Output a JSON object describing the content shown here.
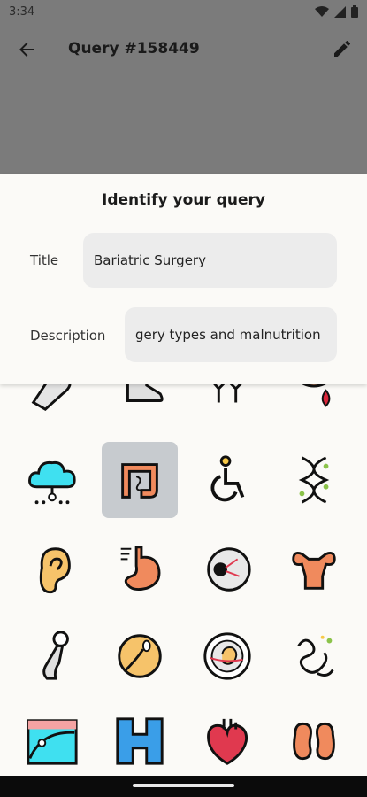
{
  "status": {
    "time": "3:34"
  },
  "appbar": {
    "title": "Query #158449"
  },
  "sheet": {
    "title": "Identify your query",
    "title_label": "Title",
    "title_value": "Bariatric Surgery",
    "description_label": "Description",
    "description_value": "gery types and malnutrition"
  },
  "icons": [
    {
      "name": "bone-icon"
    },
    {
      "name": "foot-icon"
    },
    {
      "name": "molecule-icon"
    },
    {
      "name": "blood-drop-icon"
    },
    {
      "name": "cloud-network-icon"
    },
    {
      "name": "intestine-icon",
      "selected": true
    },
    {
      "name": "wheelchair-icon"
    },
    {
      "name": "dna-icon"
    },
    {
      "name": "ear-icon"
    },
    {
      "name": "stomach-icon"
    },
    {
      "name": "eye-icon"
    },
    {
      "name": "uterus-icon"
    },
    {
      "name": "femur-icon"
    },
    {
      "name": "sperm-egg-icon"
    },
    {
      "name": "embryo-icon"
    },
    {
      "name": "gut-bacteria-icon"
    },
    {
      "name": "chart-icon"
    },
    {
      "name": "hospital-icon"
    },
    {
      "name": "heart-icon"
    },
    {
      "name": "kidneys-icon"
    }
  ],
  "colors": {
    "overlay": "#7b7b7b",
    "selected": "#c7cbcf",
    "accent_orange": "#f08a5d",
    "accent_cyan": "#3fe0f0"
  }
}
